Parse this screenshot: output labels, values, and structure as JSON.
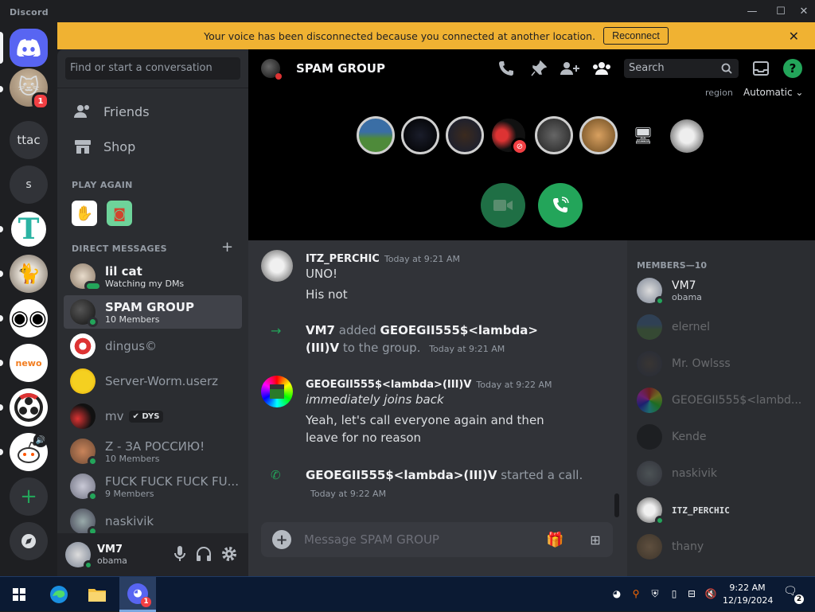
{
  "window": {
    "app_title": "Discord",
    "minimize": "—",
    "maximize": "☐",
    "close": "✕"
  },
  "servers": [
    {
      "name": "direct-messages"
    },
    {
      "name": "cat-server",
      "badge": "1"
    },
    {
      "name": "ttac",
      "label": "ttac"
    },
    {
      "name": "s",
      "label": "s"
    },
    {
      "name": "t-server"
    },
    {
      "name": "cat2"
    },
    {
      "name": "face"
    },
    {
      "name": "newo"
    },
    {
      "name": "obs"
    },
    {
      "name": "reddit"
    },
    {
      "name": "add-server",
      "label": "+"
    },
    {
      "name": "explore"
    }
  ],
  "banner": {
    "text": "Your voice has been disconnected because you connected at another location.",
    "button": "Reconnect",
    "close": "✕"
  },
  "sidebar": {
    "search_placeholder": "Find or start a conversation",
    "nav": [
      {
        "label": "Friends"
      },
      {
        "label": "Shop"
      }
    ],
    "play_again": "PLAY AGAIN",
    "dm_header": "DIRECT MESSAGES",
    "dm_add": "+",
    "dms": [
      {
        "name": "lil cat",
        "sub": "Watching my DMs",
        "bright": true
      },
      {
        "name": "SPAM GROUP",
        "sub": "10 Members",
        "selected": true
      },
      {
        "name": "dingus©",
        "sub": ""
      },
      {
        "name": "Server-Worm.userz",
        "sub": ""
      },
      {
        "name": "mv",
        "sub": "",
        "tag": "DYS"
      },
      {
        "name": "Z - ЗА РОССИЮ!",
        "sub": "10 Members"
      },
      {
        "name": "FUCK FUCK FUCK FU...",
        "sub": "9 Members"
      },
      {
        "name": "naskivik",
        "sub": ""
      }
    ]
  },
  "user": {
    "name": "VM7",
    "status": "obama"
  },
  "header": {
    "title": "SPAM GROUP",
    "search": "Search",
    "region_label": "region",
    "region_value": "Automatic"
  },
  "chat": {
    "messages": [
      {
        "author": "ITZ_PERCHIC",
        "time": "Today at 9:21 AM",
        "lines": [
          "UNO!",
          "His not"
        ]
      },
      {
        "system": true,
        "actor": "VM7",
        "verb": "added",
        "target": "GEOEGII555$<lambda>(III)V",
        "suffix": "to the group.",
        "time": "Today at 9:21 AM"
      },
      {
        "author": "GEOEGII555$<lambda>(III)V",
        "time": "Today at 9:22 AM",
        "lines": [
          "immediately joins back",
          "Yeah, let's call everyone again and then leave for no reason"
        ]
      },
      {
        "system": true,
        "actor": "GEOEGII555$<lambda>(III)V",
        "verb": "started a call.",
        "time": "Today at 9:22 AM"
      }
    ],
    "composer_placeholder": "Message SPAM GROUP"
  },
  "members": {
    "header": "MEMBERS—10",
    "list": [
      {
        "name": "VM7",
        "sub": "obama",
        "online": true
      },
      {
        "name": "elernel",
        "online": false
      },
      {
        "name": "Mr. Owlsss",
        "online": false
      },
      {
        "name": "GEOEGII555$<lambd...",
        "online": false
      },
      {
        "name": "Kende",
        "online": false
      },
      {
        "name": "naskivik",
        "online": false
      },
      {
        "name": "ITZ_PERCHIC",
        "online": true
      },
      {
        "name": "thany",
        "online": false
      }
    ]
  },
  "taskbar": {
    "time": "9:22 AM",
    "date": "12/19/2024",
    "notif_count": "2",
    "discord_badge": "1"
  },
  "colors": {
    "brand": "#5865f2",
    "online": "#23a55a",
    "banner": "#f0b232",
    "danger": "#f23f43"
  }
}
